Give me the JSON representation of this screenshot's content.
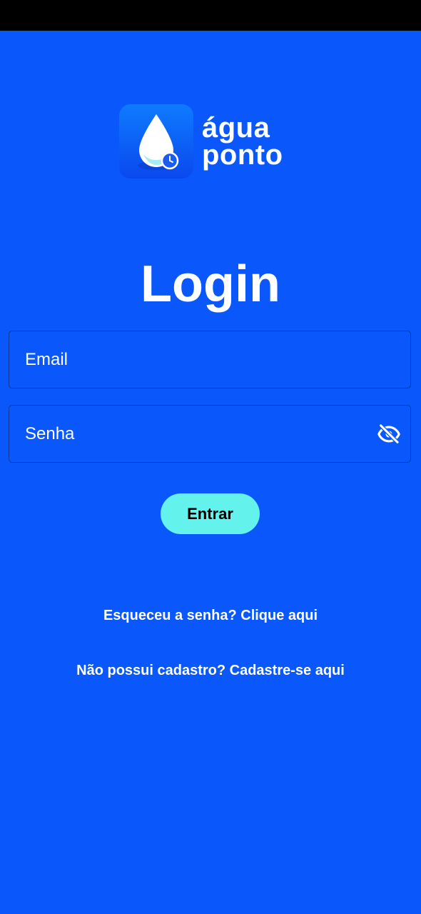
{
  "app": {
    "logo_line1": "água",
    "logo_line2": "ponto"
  },
  "page": {
    "title": "Login"
  },
  "form": {
    "email_placeholder": "Email",
    "password_placeholder": "Senha",
    "submit_label": "Entrar"
  },
  "links": {
    "forgot_password": "Esqueceu a senha? Clique aqui",
    "signup": "Não possui cadastro? Cadastre-se aqui"
  },
  "icons": {
    "logo": "water-drop-clock-icon",
    "password_toggle": "eye-off-icon"
  },
  "colors": {
    "background": "#0a57fb",
    "button": "#63f2ec",
    "status_bar": "#000000"
  }
}
